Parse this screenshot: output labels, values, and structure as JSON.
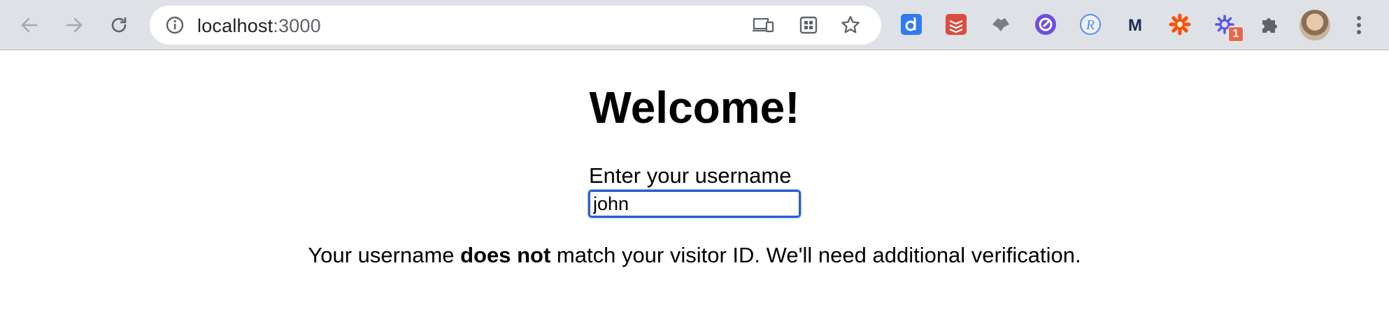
{
  "browser": {
    "url_host": "localhost",
    "url_port": ":3000",
    "extensions": [
      {
        "name": "dashlane-extension-icon",
        "color": "#2f7af5"
      },
      {
        "name": "todoist-extension-icon",
        "color": "#db4c3f"
      },
      {
        "name": "wolf-extension-icon",
        "color": "#7a7d82"
      },
      {
        "name": "purple-circle-extension-icon",
        "color": "#6b4ce6"
      },
      {
        "name": "r-extension-icon",
        "color": "#5a8ede"
      },
      {
        "name": "m-extension-icon",
        "color": "#1d2b4f"
      },
      {
        "name": "zapier-extension-icon",
        "color": "#ff4f00"
      },
      {
        "name": "cog-extension-icon",
        "color": "#5b55e8"
      }
    ],
    "badge_count": "1"
  },
  "page": {
    "heading": "Welcome!",
    "input_label": "Enter your username",
    "input_value": "john",
    "message_prefix": "Your username ",
    "message_bold": "does not",
    "message_suffix": " match your visitor ID. We'll need additional verification."
  }
}
